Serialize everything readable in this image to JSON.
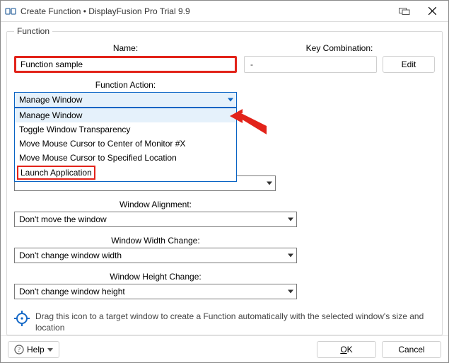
{
  "window": {
    "title": "Create Function • DisplayFusion Pro Trial 9.9"
  },
  "group": {
    "legend": "Function"
  },
  "name": {
    "label": "Name:",
    "value": "Function sample"
  },
  "keycombo": {
    "label": "Key Combination:",
    "value": "-",
    "edit": "Edit"
  },
  "action": {
    "label": "Function Action:",
    "selected": "Manage Window",
    "options": [
      "Manage Window",
      "Toggle Window Transparency",
      "Move Mouse Cursor to Center of Monitor #X",
      "Move Mouse Cursor to Specified Location",
      "Launch Application"
    ]
  },
  "alignment": {
    "label": "Window Alignment:",
    "value": "Don't move the window"
  },
  "width": {
    "label": "Window Width Change:",
    "value": "Don't change window width"
  },
  "height": {
    "label": "Window Height Change:",
    "value": "Don't change window height"
  },
  "hidden_combo_value": "",
  "hint": "Drag this icon to a target window to create a Function automatically with the selected window's size and location",
  "footer": {
    "help": "Help",
    "ok": "OK",
    "cancel": "Cancel"
  }
}
